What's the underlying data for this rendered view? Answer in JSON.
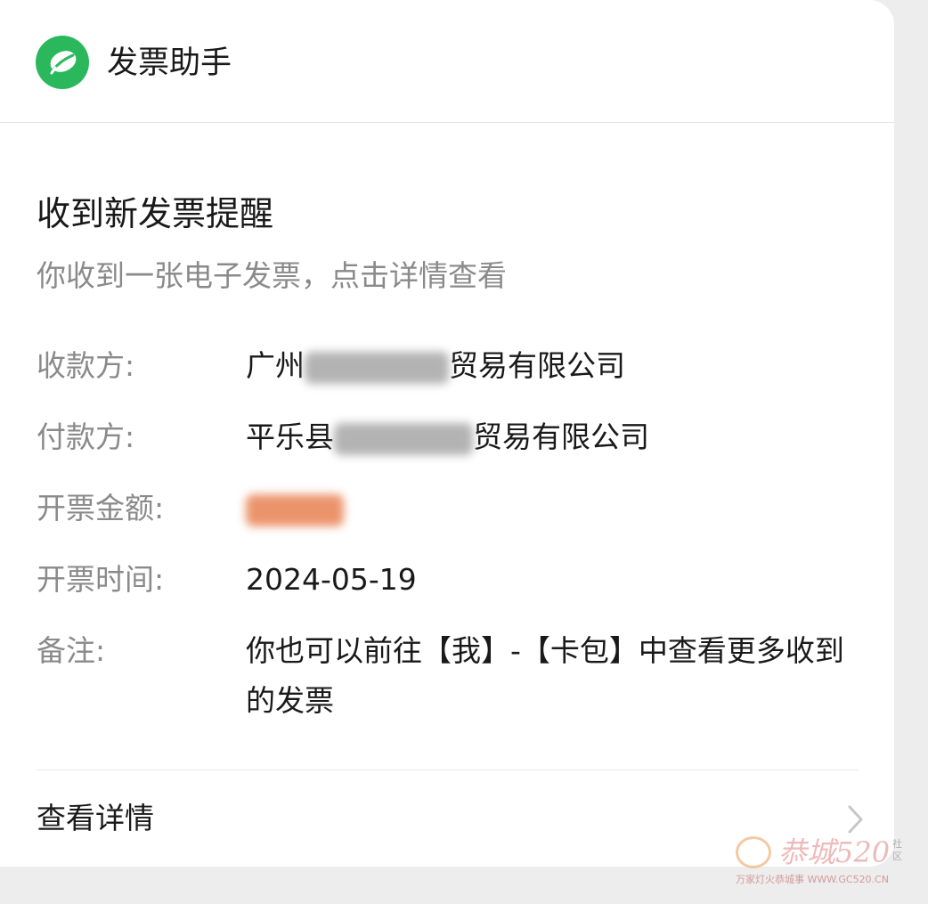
{
  "header": {
    "app_name": "发票助手",
    "icon": "invoice-assistant-leaf-icon",
    "icon_color": "#2bb85c"
  },
  "message": {
    "title": "收到新发票提醒",
    "subtitle": "你收到一张电子发票，点击详情查看"
  },
  "fields": {
    "payee": {
      "label": "收款方:",
      "value_prefix": "广州",
      "value_suffix": "贸易有限公司"
    },
    "payer": {
      "label": "付款方:",
      "value_prefix": "平乐县",
      "value_suffix": "贸易有限公司"
    },
    "amount": {
      "label": "开票金额:"
    },
    "date": {
      "label": "开票时间:",
      "value": "2024-05-19"
    },
    "note": {
      "label": "备注:",
      "value": "你也可以前往【我】-【卡包】中查看更多收到的发票"
    }
  },
  "footer": {
    "label": "查看详情",
    "icon": "chevron-right-icon"
  },
  "watermark": {
    "main": "恭城520",
    "side": "社区",
    "sub": "万家灯火恭城事 WWW.GC520.CN"
  }
}
